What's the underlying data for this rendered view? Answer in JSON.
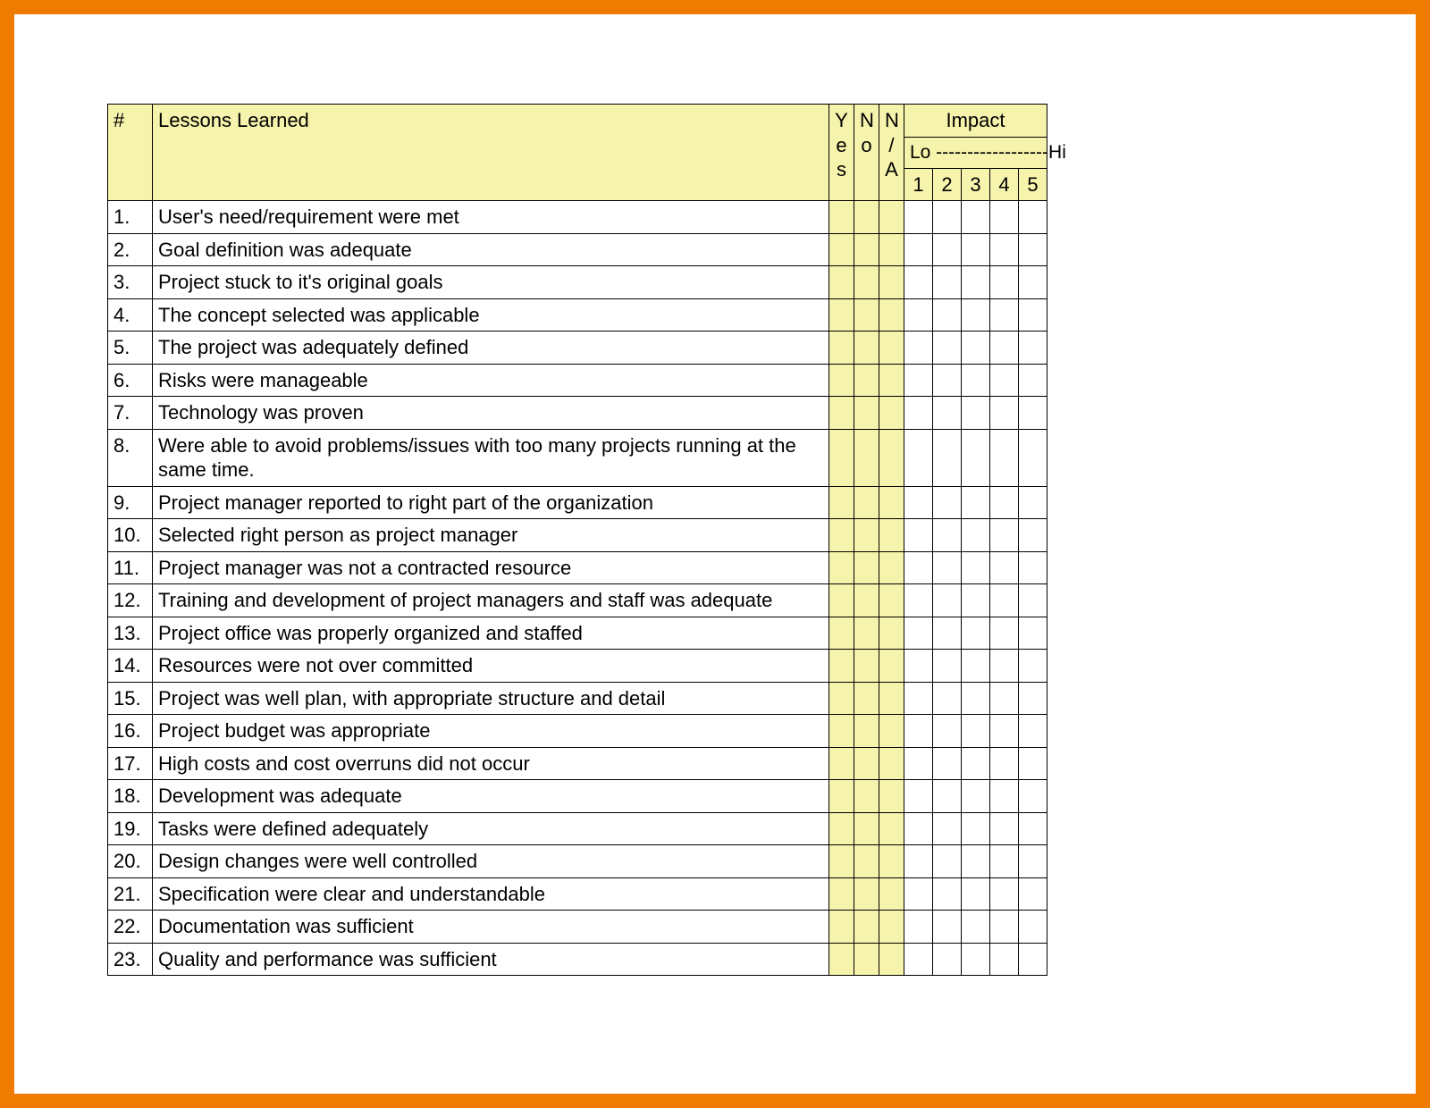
{
  "header": {
    "num": "#",
    "lessons": "Lessons Learned",
    "yes": "Yes",
    "no": "No",
    "na": "N/A",
    "impact": "Impact",
    "lo_hi": "Lo ------------------Hi",
    "scale": [
      "1",
      "2",
      "3",
      "4",
      "5"
    ]
  },
  "rows": [
    {
      "n": "1.",
      "t": "User's need/requirement were met"
    },
    {
      "n": "2.",
      "t": "Goal definition was adequate"
    },
    {
      "n": "3.",
      "t": "Project stuck to it's original goals"
    },
    {
      "n": "4.",
      "t": "The concept selected was applicable"
    },
    {
      "n": "5.",
      "t": "The project was adequately defined"
    },
    {
      "n": "6.",
      "t": "Risks were manageable"
    },
    {
      "n": "7.",
      "t": "Technology was proven"
    },
    {
      "n": "8.",
      "t": "Were able to avoid problems/issues with too many projects running at the same time."
    },
    {
      "n": "9.",
      "t": "Project manager reported to right part of the organization"
    },
    {
      "n": "10.",
      "t": "Selected right person as project manager"
    },
    {
      "n": "11.",
      "t": "Project manager was not a contracted resource"
    },
    {
      "n": "12.",
      "t": "Training and development of project managers and staff was adequate"
    },
    {
      "n": "13.",
      "t": "Project office was properly organized and staffed"
    },
    {
      "n": "14.",
      "t": "Resources were not over committed"
    },
    {
      "n": "15.",
      "t": "Project was well plan, with appropriate structure and detail"
    },
    {
      "n": "16.",
      "t": "Project budget was appropriate"
    },
    {
      "n": "17.",
      "t": "High costs and cost overruns did not occur"
    },
    {
      "n": "18.",
      "t": "Development was adequate"
    },
    {
      "n": "19.",
      "t": "Tasks were defined adequately"
    },
    {
      "n": "20.",
      "t": "Design changes were well controlled"
    },
    {
      "n": "21.",
      "t": "Specification were clear and understandable"
    },
    {
      "n": "22.",
      "t": "Documentation was sufficient"
    },
    {
      "n": "23.",
      "t": "Quality and performance was sufficient"
    }
  ]
}
